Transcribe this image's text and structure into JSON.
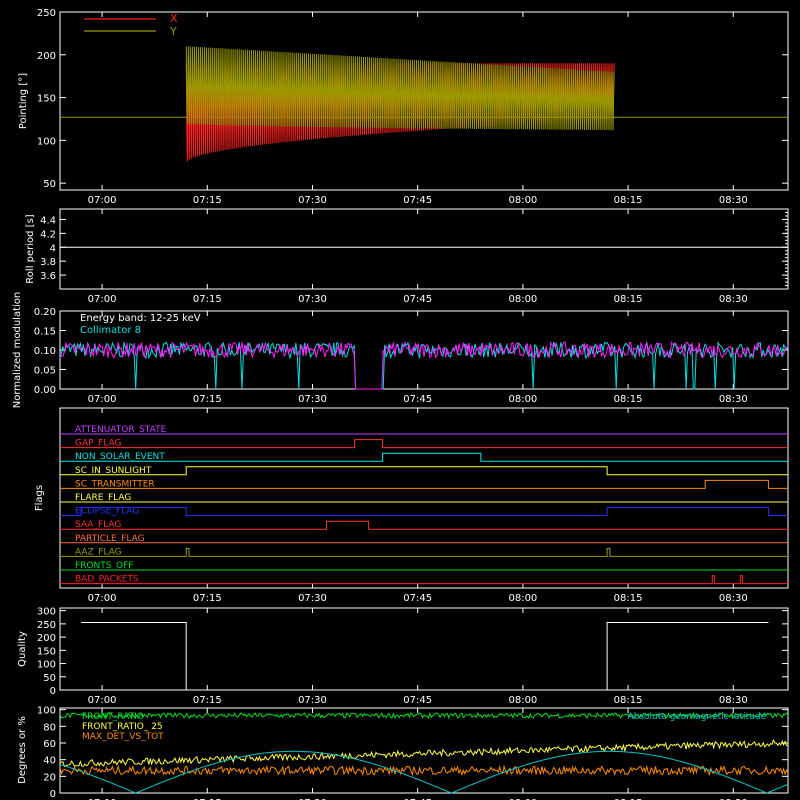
{
  "time_axis": {
    "ticks": [
      "07:00",
      "07:15",
      "07:30",
      "07:45",
      "08:00",
      "08:15",
      "08:30"
    ],
    "tick_hours": [
      7.0,
      7.25,
      7.5,
      7.75,
      8.0,
      8.25,
      8.5
    ],
    "range": [
      6.9,
      8.63
    ]
  },
  "colors": {
    "x_series": "#ff2020",
    "y_series": "#9a9a00",
    "collimator": "#00e0e0",
    "modulation": "#ff20ff",
    "front_ratio": "#00e020",
    "front_ratio_25": "#ffff40",
    "max_det": "#ff8c00",
    "mag_lat": "#00c8c8"
  },
  "chart_data": [
    {
      "type": "line",
      "ylabel": "Pointing [°]",
      "ylim": [
        42,
        250
      ],
      "yticks": [
        50,
        100,
        150,
        200,
        250
      ],
      "legend": [
        "X",
        "Y"
      ],
      "legend_position": "top-left",
      "series": [
        {
          "name": "X",
          "x_start": "07:12",
          "x_end": "08:13",
          "min_start": 73,
          "min_end": 125,
          "max_start": 190,
          "max_end": 190
        },
        {
          "name": "Y",
          "x_start": "07:12",
          "x_end": "08:13",
          "min_start": 120,
          "min_end": 112,
          "max_start": 210,
          "max_end": 180
        }
      ],
      "baseline": 127
    },
    {
      "type": "line",
      "ylabel": "Roll period [s]",
      "ylim": [
        3.4,
        4.55
      ],
      "yticks": [
        3.6,
        3.8,
        4.0,
        4.2,
        4.4
      ],
      "value": 4.0
    },
    {
      "type": "line",
      "ylabel": "Normalized modulation",
      "ylim": [
        0.0,
        0.2
      ],
      "yticks": [
        "0.00",
        "0.05",
        "0.10",
        "0.15",
        "0.20"
      ],
      "annotation": "Energy band: 12-25 keV",
      "legend": [
        "Collimator 8"
      ],
      "mean": 0.1,
      "gap": [
        "07:36",
        "07:40"
      ]
    },
    {
      "type": "step",
      "ylabel": "Flags",
      "flags": [
        {
          "label": "ATTENUATOR_STATE",
          "color": "#c040ff",
          "on": []
        },
        {
          "label": "GAP_FLAG",
          "color": "#ff3030",
          "on": [
            [
              "07:36",
              "07:40"
            ]
          ]
        },
        {
          "label": "NON_SOLAR_EVENT",
          "color": "#00e8e8",
          "on": [
            [
              "07:40",
              "07:54"
            ]
          ]
        },
        {
          "label": "SC_IN_SUNLIGHT",
          "color": "#ffff40",
          "on": [
            [
              "07:12",
              "08:12"
            ]
          ]
        },
        {
          "label": "SC_TRANSMITTER",
          "color": "#ff8c00",
          "on": [
            [
              "08:26",
              "08:35"
            ]
          ]
        },
        {
          "label": "FLARE_FLAG",
          "color": "#ffff40",
          "on": []
        },
        {
          "label": "ECLIPSE_FLAG",
          "color": "#2030ff",
          "on": [
            [
              "06:57",
              "07:12"
            ],
            [
              "08:12",
              "08:35"
            ]
          ]
        },
        {
          "label": "SAA_FLAG",
          "color": "#ff3030",
          "on": [
            [
              "07:32",
              "07:38"
            ]
          ]
        },
        {
          "label": "PARTICLE_FLAG",
          "color": "#ff7040",
          "on": []
        },
        {
          "label": "AAZ_FLAG",
          "color": "#9a9a00",
          "on": [
            [
              "07:12",
              "07:12.4"
            ],
            [
              "08:12",
              "08:12.4"
            ]
          ]
        },
        {
          "label": "FRONTS_OFF",
          "color": "#00e020",
          "on": []
        },
        {
          "label": "BAD_PACKETS",
          "color": "#ff2020",
          "on": [
            [
              "08:27",
              "08:27.3"
            ],
            [
              "08:31",
              "08:31.3"
            ]
          ]
        }
      ]
    },
    {
      "type": "step",
      "ylabel": "Quality",
      "ylim": [
        0,
        310
      ],
      "yticks": [
        0,
        50,
        100,
        150,
        200,
        250,
        300
      ],
      "segments": [
        {
          "from": "06:57",
          "to": "07:12",
          "value": 255
        },
        {
          "from": "07:12",
          "to": "08:12",
          "value": 0
        },
        {
          "from": "08:12",
          "to": "08:35",
          "value": 255
        }
      ]
    },
    {
      "type": "line",
      "ylabel": "Degrees or %",
      "ylim": [
        0,
        102
      ],
      "yticks": [
        0,
        20,
        40,
        60,
        80,
        100
      ],
      "legend": [
        "FRONT_RATIO",
        "FRONT_RATIO_ 25",
        "MAX_DET_VS_TOT"
      ],
      "legend_right": "Absolute geomagnetic latitude",
      "series": [
        {
          "name": "FRONT_RATIO",
          "level": 93
        },
        {
          "name": "FRONT_RATIO_ 25",
          "level_start": 35,
          "level_end": 60
        },
        {
          "name": "MAX_DET_VS_TOT",
          "level": 27
        },
        {
          "name": "Absolute geomagnetic latitude",
          "min": 0,
          "max": 50
        }
      ]
    }
  ]
}
